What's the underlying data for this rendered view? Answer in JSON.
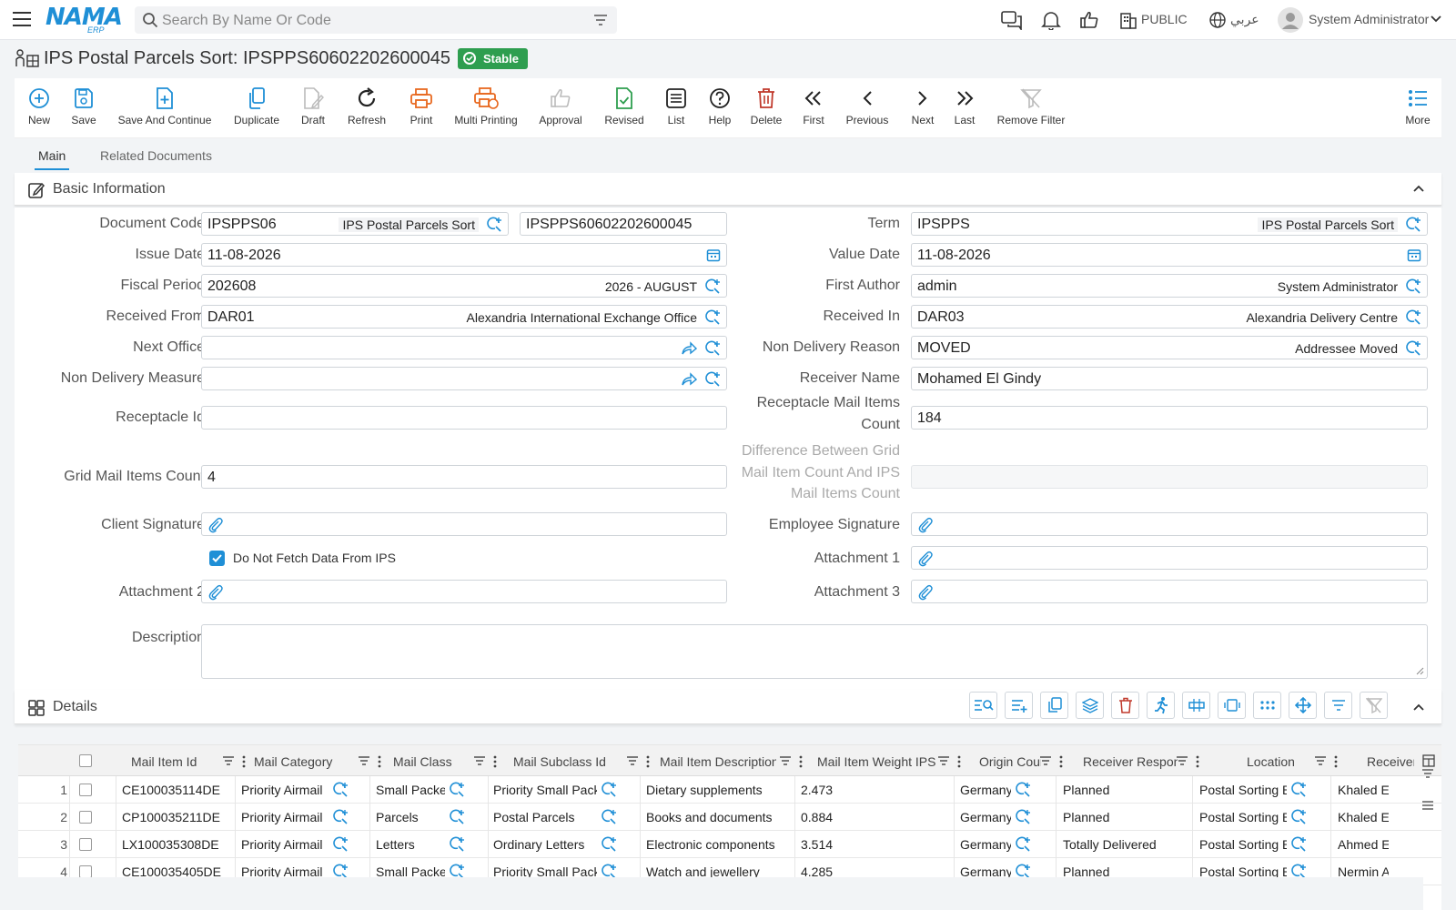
{
  "topbar": {
    "logo_text": "NAMA",
    "logo_sub": "ERP",
    "search_placeholder": "Search By Name Or Code",
    "company": "PUBLIC",
    "language": "عربي",
    "user": "System Administrator"
  },
  "header": {
    "title": "IPS Postal Parcels Sort: IPSPPS60602202600045",
    "status": "Stable"
  },
  "toolbar": {
    "new": "New",
    "save": "Save",
    "save_continue": "Save And Continue",
    "duplicate": "Duplicate",
    "draft": "Draft",
    "refresh": "Refresh",
    "print": "Print",
    "multi_printing": "Multi Printing",
    "approval": "Approval",
    "revised": "Revised",
    "list": "List",
    "help": "Help",
    "delete": "Delete",
    "first": "First",
    "previous": "Previous",
    "next": "Next",
    "last": "Last",
    "remove_filter": "Remove Filter",
    "more": "More"
  },
  "tabs": {
    "main": "Main",
    "related": "Related Documents"
  },
  "basic": {
    "section_title": "Basic Information",
    "document_code_label": "Document Code",
    "document_code": "IPSPPS06",
    "document_code_desc": "IPS Postal Parcels Sort",
    "document_number": "IPSPPS60602202600045",
    "term_label": "Term",
    "term": "IPSPPS",
    "term_desc": "IPS Postal Parcels Sort",
    "issue_date_label": "Issue Date",
    "issue_date": "11-08-2026",
    "value_date_label": "Value Date",
    "value_date": "11-08-2026",
    "fiscal_period_label": "Fiscal Period",
    "fiscal_period": "202608",
    "fiscal_period_desc": "2026 - AUGUST",
    "first_author_label": "First Author",
    "first_author": "admin",
    "first_author_desc": "System Administrator",
    "received_from_label": "Received From",
    "received_from": "DAR01",
    "received_from_desc": "Alexandria International Exchange Office",
    "received_in_label": "Received In",
    "received_in": "DAR03",
    "received_in_desc": "Alexandria Delivery Centre",
    "next_office_label": "Next Office",
    "non_delivery_reason_label": "Non Delivery Reason",
    "non_delivery_reason": "MOVED",
    "non_delivery_reason_desc": "Addressee Moved",
    "non_delivery_measure_label": "Non Delivery Measure",
    "receiver_name_label": "Receiver Name",
    "receiver_name": "Mohamed El Gindy",
    "receptacle_id_label": "Receptacle Id",
    "receptacle_count_label_1": "Receptacle Mail Items",
    "receptacle_count_label_2": "Count",
    "receptacle_count": "184",
    "grid_count_label": "Grid Mail Items Count",
    "grid_count": "4",
    "difference_label_1": "Difference Between Grid",
    "difference_label_2": "Mail Item Count And IPS",
    "difference_label_3": "Mail Items Count",
    "client_signature_label": "Client Signature",
    "employee_signature_label": "Employee Signature",
    "do_not_fetch_label": "Do Not Fetch Data From IPS",
    "attachment1_label": "Attachment 1",
    "attachment2_label": "Attachment 2",
    "attachment3_label": "Attachment 3",
    "description_label": "Description"
  },
  "details": {
    "section_title": "Details",
    "columns": [
      "Mail Item Id",
      "Mail Category",
      "Mail Class",
      "Mail Subclass Id",
      "Mail Item Description",
      "Mail Item Weight IPS",
      "Origin Country",
      "Receiver Response",
      "Location",
      "Receiver"
    ],
    "rows": [
      {
        "n": "1",
        "id": "CE100035114DE",
        "category": "Priority Airmail",
        "class": "Small Packets",
        "subclass": "Priority Small Packets",
        "description": "Dietary supplements",
        "weight": "2.473",
        "origin": "Germany",
        "response": "Planned",
        "location": "Postal Sorting Bay",
        "receiver": "Khaled E"
      },
      {
        "n": "2",
        "id": "CP100035211DE",
        "category": "Priority Airmail",
        "class": "Parcels",
        "subclass": "Postal Parcels",
        "description": "Books and documents",
        "weight": "0.884",
        "origin": "Germany",
        "response": "Planned",
        "location": "Postal Sorting Bay",
        "receiver": "Khaled E"
      },
      {
        "n": "3",
        "id": "LX100035308DE",
        "category": "Priority Airmail",
        "class": "Letters",
        "subclass": "Ordinary Letters",
        "description": "Electronic components",
        "weight": "3.514",
        "origin": "Germany",
        "response": "Totally Delivered",
        "location": "Postal Sorting Bay",
        "receiver": "Ahmed E"
      },
      {
        "n": "4",
        "id": "CE100035405DE",
        "category": "Priority Airmail",
        "class": "Small Packets",
        "subclass": "Priority Small Packets",
        "description": "Watch and jewellery",
        "weight": "4.285",
        "origin": "Germany",
        "response": "Planned",
        "location": "Postal Sorting Bay",
        "receiver": "Nermin A"
      }
    ]
  },
  "colors": {
    "accent": "#1f8fd6",
    "stable": "#2e9e4f",
    "delete": "#c0392b",
    "print": "#e8681f",
    "revised": "#2e9e4f"
  }
}
